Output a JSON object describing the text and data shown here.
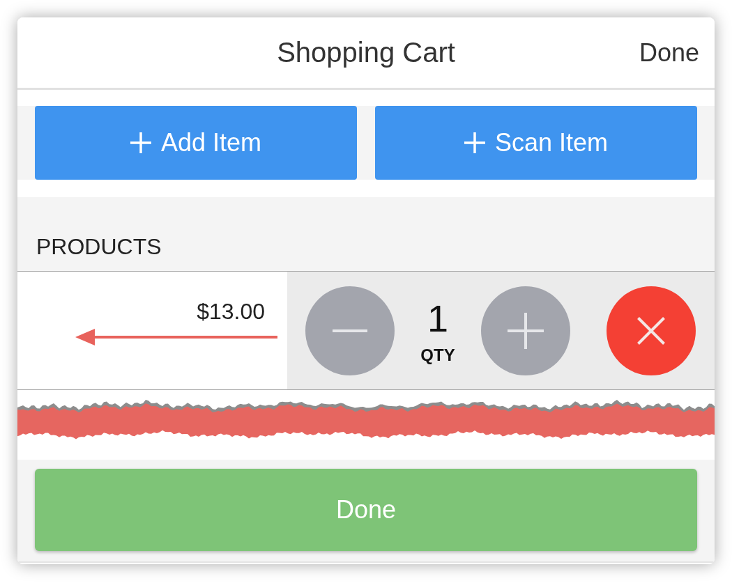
{
  "header": {
    "title": "Shopping Cart",
    "done_label": "Done"
  },
  "actions": [
    {
      "label": "Add Item"
    },
    {
      "label": "Scan Item"
    }
  ],
  "products_section": {
    "heading": "PRODUCTS",
    "items": [
      {
        "price": "$13.00",
        "quantity": "1",
        "quantity_label": "QTY"
      }
    ]
  },
  "footer": {
    "button_label": "Done"
  }
}
